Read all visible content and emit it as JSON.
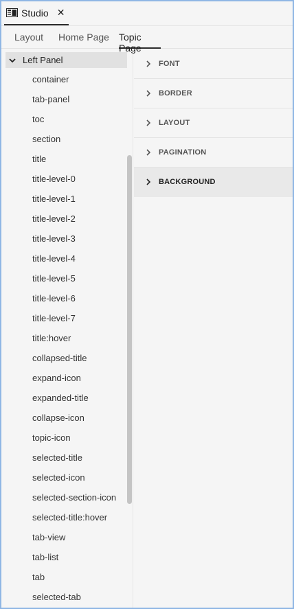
{
  "window": {
    "title": "Studio",
    "close_glyph": "✕"
  },
  "tabs": [
    {
      "label": "Layout",
      "active": false
    },
    {
      "label": "Home Page",
      "active": false
    },
    {
      "label": "Topic Page",
      "active": true
    }
  ],
  "left_panel": {
    "header": "Left Panel",
    "items": [
      "container",
      "tab-panel",
      "toc",
      "section",
      "title",
      "title-level-0",
      "title-level-1",
      "title-level-2",
      "title-level-3",
      "title-level-4",
      "title-level-5",
      "title-level-6",
      "title-level-7",
      "title:hover",
      "collapsed-title",
      "expand-icon",
      "expanded-title",
      "collapse-icon",
      "topic-icon",
      "selected-title",
      "selected-icon",
      "selected-section-icon",
      "selected-title:hover",
      "tab-view",
      "tab-list",
      "tab",
      "selected-tab"
    ]
  },
  "properties": {
    "sections": [
      {
        "label": "FONT",
        "selected": false
      },
      {
        "label": "BORDER",
        "selected": false
      },
      {
        "label": "LAYOUT",
        "selected": false
      },
      {
        "label": "PAGINATION",
        "selected": false
      },
      {
        "label": "BACKGROUND",
        "selected": true
      }
    ]
  },
  "colors": {
    "frame": "#8fb6e4",
    "panel_bg": "#f5f5f5",
    "selected_bg": "#e9e9e9"
  },
  "icons": {
    "app": "studio-app-icon",
    "close": "close-icon",
    "expand": "chevron-down-icon",
    "collapsed": "chevron-right-icon"
  }
}
